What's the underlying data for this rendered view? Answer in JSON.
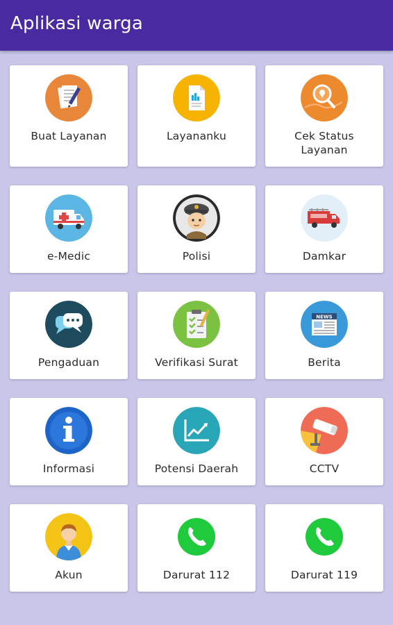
{
  "appbar": {
    "title": "Aplikasi warga",
    "color": "#4a2aa0"
  },
  "background": "#c9c6ea",
  "tiles": [
    {
      "label": "Buat Layanan",
      "icon": "document-pen-icon",
      "color": "#e8873a"
    },
    {
      "label": "Layananku",
      "icon": "file-icon",
      "color": "#f6b400"
    },
    {
      "label": "Cek Status Layanan",
      "icon": "map-search-icon",
      "color": "#ee8a2e"
    },
    {
      "label": "e-Medic",
      "icon": "ambulance-icon",
      "color": "#5bb6e3"
    },
    {
      "label": "Polisi",
      "icon": "police-icon",
      "color": "#2b2b2b"
    },
    {
      "label": "Damkar",
      "icon": "fire-truck-icon",
      "color": "#e2eef8"
    },
    {
      "label": "Pengaduan",
      "icon": "chat-icon",
      "color": "#1e4b5e"
    },
    {
      "label": "Verifikasi Surat",
      "icon": "clipboard-check-icon",
      "color": "#7cc242"
    },
    {
      "label": "Berita",
      "icon": "newspaper-icon",
      "color": "#3a9ad9"
    },
    {
      "label": "Informasi",
      "icon": "info-icon",
      "color": "#1e63c8"
    },
    {
      "label": "Potensi Daerah",
      "icon": "chart-up-icon",
      "color": "#28a6b8"
    },
    {
      "label": "CCTV",
      "icon": "cctv-camera-icon",
      "color": "#ef6b55"
    },
    {
      "label": "Akun",
      "icon": "user-avatar-icon",
      "color": "#f3c316"
    },
    {
      "label": "Darurat 112",
      "icon": "phone-icon",
      "color": "#1fca3d"
    },
    {
      "label": "Darurat 119",
      "icon": "phone-icon",
      "color": "#1fca3d"
    }
  ]
}
